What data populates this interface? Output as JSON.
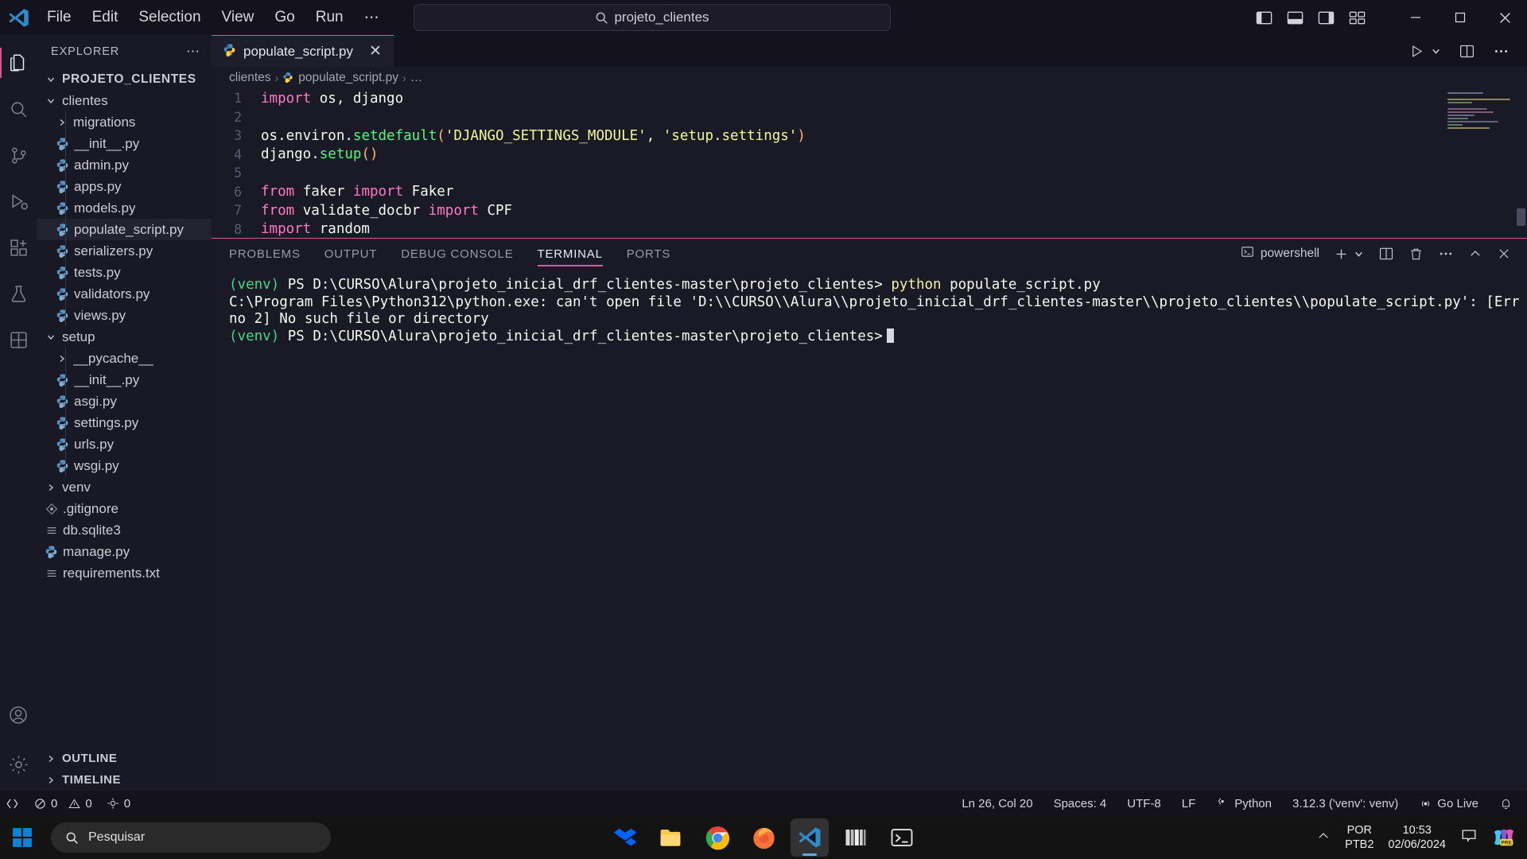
{
  "titlebar": {
    "menu": [
      "File",
      "Edit",
      "Selection",
      "View",
      "Go",
      "Run",
      "⋯"
    ],
    "search_value": "projeto_clientes",
    "back_arrow": "←",
    "forward_arrow": "→"
  },
  "activitybar": {
    "items": [
      {
        "name": "explorer",
        "icon": "files-icon"
      },
      {
        "name": "search",
        "icon": "search-icon"
      },
      {
        "name": "source-control",
        "icon": "source-control-icon"
      },
      {
        "name": "run-and-debug",
        "icon": "debug-icon"
      },
      {
        "name": "extensions",
        "icon": "extensions-icon"
      },
      {
        "name": "testing",
        "icon": "beaker-icon"
      },
      {
        "name": "remote-explorer",
        "icon": "remote-icon"
      }
    ],
    "bottom": [
      {
        "name": "accounts",
        "icon": "account-icon"
      },
      {
        "name": "settings",
        "icon": "gear-icon"
      }
    ]
  },
  "sidebar": {
    "title": "EXPLORER",
    "more_label": "⋯",
    "root": "PROJETO_CLIENTES",
    "tree": [
      {
        "label": "clientes",
        "type": "folder",
        "indent": 1,
        "expanded": true
      },
      {
        "label": "migrations",
        "type": "folder",
        "indent": 2,
        "expanded": false
      },
      {
        "label": "__init__.py",
        "type": "python",
        "indent": 2
      },
      {
        "label": "admin.py",
        "type": "python",
        "indent": 2
      },
      {
        "label": "apps.py",
        "type": "python",
        "indent": 2
      },
      {
        "label": "models.py",
        "type": "python",
        "indent": 2
      },
      {
        "label": "populate_script.py",
        "type": "python",
        "indent": 2,
        "selected": true
      },
      {
        "label": "serializers.py",
        "type": "python",
        "indent": 2
      },
      {
        "label": "tests.py",
        "type": "python",
        "indent": 2
      },
      {
        "label": "validators.py",
        "type": "python",
        "indent": 2
      },
      {
        "label": "views.py",
        "type": "python",
        "indent": 2
      },
      {
        "label": "setup",
        "type": "folder",
        "indent": 1,
        "expanded": true
      },
      {
        "label": "__pycache__",
        "type": "folder",
        "indent": 2,
        "expanded": false
      },
      {
        "label": "__init__.py",
        "type": "python",
        "indent": 2
      },
      {
        "label": "asgi.py",
        "type": "python",
        "indent": 2
      },
      {
        "label": "settings.py",
        "type": "python",
        "indent": 2
      },
      {
        "label": "urls.py",
        "type": "python",
        "indent": 2
      },
      {
        "label": "wsgi.py",
        "type": "python",
        "indent": 2
      },
      {
        "label": "venv",
        "type": "folder",
        "indent": 1,
        "expanded": false
      },
      {
        "label": ".gitignore",
        "type": "git",
        "indent": 1
      },
      {
        "label": "db.sqlite3",
        "type": "file",
        "indent": 1
      },
      {
        "label": "manage.py",
        "type": "python",
        "indent": 1
      },
      {
        "label": "requirements.txt",
        "type": "file",
        "indent": 1
      }
    ],
    "sections": [
      "OUTLINE",
      "TIMELINE"
    ]
  },
  "editor": {
    "tab_label": "populate_script.py",
    "tab_close": "✕",
    "breadcrumb": [
      "clientes",
      "populate_script.py",
      "…"
    ],
    "actions": [
      "run-icon",
      "run-dropdown-icon",
      "split-editor-icon",
      "more-actions-icon"
    ],
    "lines": [
      {
        "no": "1",
        "tokens": [
          {
            "t": "import",
            "c": "k"
          },
          {
            "t": " os, django",
            "c": "n"
          }
        ]
      },
      {
        "no": "2",
        "tokens": []
      },
      {
        "no": "3",
        "tokens": [
          {
            "t": "os.environ.",
            "c": "n"
          },
          {
            "t": "setdefault",
            "c": "f"
          },
          {
            "t": "(",
            "c": "p"
          },
          {
            "t": "'DJANGO_SETTINGS_MODULE'",
            "c": "s"
          },
          {
            "t": ", ",
            "c": "n"
          },
          {
            "t": "'setup.settings'",
            "c": "s"
          },
          {
            "t": ")",
            "c": "p"
          }
        ]
      },
      {
        "no": "4",
        "tokens": [
          {
            "t": "django.",
            "c": "n"
          },
          {
            "t": "setup",
            "c": "f"
          },
          {
            "t": "()",
            "c": "p"
          }
        ]
      },
      {
        "no": "5",
        "tokens": []
      },
      {
        "no": "6",
        "tokens": [
          {
            "t": "from",
            "c": "k"
          },
          {
            "t": " faker ",
            "c": "n"
          },
          {
            "t": "import",
            "c": "k"
          },
          {
            "t": " Faker",
            "c": "n"
          }
        ]
      },
      {
        "no": "7",
        "tokens": [
          {
            "t": "from",
            "c": "k"
          },
          {
            "t": " validate_docbr ",
            "c": "n"
          },
          {
            "t": "import",
            "c": "k"
          },
          {
            "t": " CPF",
            "c": "n"
          }
        ]
      },
      {
        "no": "8",
        "tokens": [
          {
            "t": "import",
            "c": "k"
          },
          {
            "t": " random",
            "c": "n"
          }
        ]
      }
    ]
  },
  "panel": {
    "tabs": [
      "PROBLEMS",
      "OUTPUT",
      "DEBUG CONSOLE",
      "TERMINAL",
      "PORTS"
    ],
    "active_tab": "TERMINAL",
    "shell_label": "powershell",
    "actions": [
      "new-terminal-icon",
      "terminal-dropdown-icon",
      "split-terminal-icon",
      "kill-terminal-icon",
      "more-actions-icon",
      "chevron-up-icon",
      "close-icon"
    ],
    "terminal_lines": [
      [
        {
          "t": "(venv)",
          "c": "venv"
        },
        {
          "t": " PS D:\\CURSO\\Alura\\projeto_inicial_drf_clientes-master\\projeto_clientes> ",
          "c": "n"
        },
        {
          "t": "python",
          "c": "ylw"
        },
        {
          "t": " populate_script.py",
          "c": "n"
        }
      ],
      [
        {
          "t": "C:\\Program Files\\Python312\\python.exe: can't open file 'D:\\\\CURSO\\\\Alura\\\\projeto_inicial_drf_clientes-master\\\\projeto_clientes\\\\populate_script.py': [Errno 2] No such file or directory",
          "c": "n"
        }
      ],
      [
        {
          "t": "(venv)",
          "c": "venv"
        },
        {
          "t": " PS D:\\CURSO\\Alura\\projeto_inicial_drf_clientes-master\\projeto_clientes>",
          "c": "n"
        },
        {
          "t": "CURSOR",
          "c": "cursor"
        }
      ]
    ]
  },
  "statusbar": {
    "remote_icon": "remote-window-icon",
    "errors": "0",
    "warnings": "0",
    "ports": "0",
    "position": "Ln 26, Col 20",
    "indentation": "Spaces: 4",
    "encoding": "UTF-8",
    "eol": "LF",
    "language": "Python",
    "interpreter": "3.12.3 ('venv': venv)",
    "golive": "Go Live",
    "bell_icon": "bell-icon"
  },
  "taskbar": {
    "start_icon": "windows-start-icon",
    "search_placeholder": "Pesquisar",
    "apps": [
      {
        "name": "dropbox",
        "icon": "dropbox-icon"
      },
      {
        "name": "file-explorer",
        "icon": "folder-icon"
      },
      {
        "name": "google-chrome",
        "icon": "chrome-icon"
      },
      {
        "name": "firefox",
        "icon": "firefox-icon"
      },
      {
        "name": "visual-studio-code",
        "icon": "vscode-icon",
        "active": true
      },
      {
        "name": "books-app",
        "icon": "books-icon"
      },
      {
        "name": "terminal",
        "icon": "terminal-icon"
      }
    ],
    "chevron": "⌃",
    "lang_line1": "POR",
    "lang_line2": "PTB2",
    "time": "10:53",
    "date": "02/06/2024",
    "notification_icon": "chat-icon",
    "copilot_badge": "PRE"
  }
}
